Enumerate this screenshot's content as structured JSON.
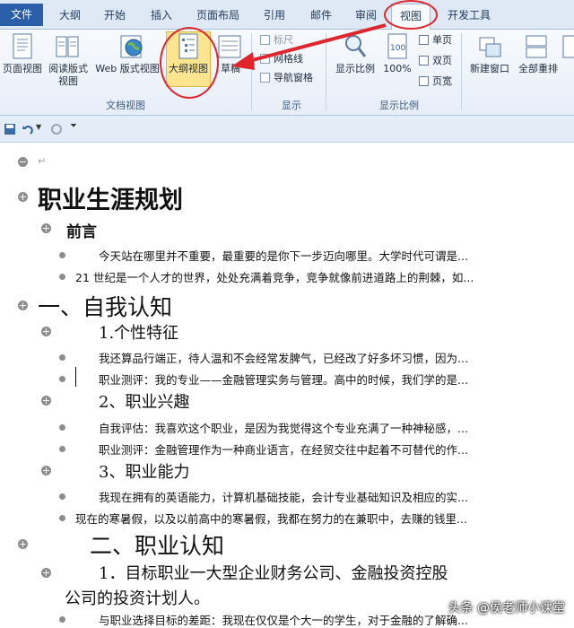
{
  "tabs": [
    "文件",
    "大纲",
    "开始",
    "插入",
    "页面布局",
    "引用",
    "邮件",
    "审阅",
    "视图",
    "开发工具"
  ],
  "ribbon": {
    "doc_views": {
      "buttons": [
        "页面视图",
        "阅读版式\n视图",
        "Web 版式视图",
        "大纲视图",
        "草稿"
      ],
      "label": "文档视图"
    },
    "show": {
      "items": [
        "标尺",
        "网格线",
        "导航窗格"
      ],
      "label": "显示"
    },
    "zoom": {
      "buttons": [
        "显示比例",
        "100%"
      ],
      "small": [
        "单页",
        "双页",
        "页宽"
      ],
      "label": "显示比例"
    },
    "window": {
      "buttons": [
        "新建窗口",
        "全部重排"
      ]
    }
  },
  "document": {
    "lines": [
      {
        "text": "",
        "style": "empty"
      },
      {
        "text": "职业生涯规划",
        "style": "h1"
      },
      {
        "text": "前言",
        "style": "h2"
      },
      {
        "text": "今天站在哪里并不重要，最重要的是你下一步迈向哪里。大学时代可谓是...",
        "style": "body"
      },
      {
        "text": "21 世纪是一个人才的世界，处处充满着竞争，竞争就像前进道路上的荆棘，如...",
        "style": "body"
      },
      {
        "text": "一、自我认知",
        "style": "h1b"
      },
      {
        "text": "1.个性特征",
        "style": "h3"
      },
      {
        "text": "我还算品行端正，待人温和不会经常发脾气，已经改了好多坏习惯，因为...",
        "style": "body"
      },
      {
        "text": "职业测评：我的专业——金融管理实务与管理。高中的时候，我们学的是...",
        "style": "body"
      },
      {
        "text": "2、职业兴趣",
        "style": "h3"
      },
      {
        "text": "自我评估：我喜欢这个职业，是因为我觉得这个专业充满了一种神秘感，...",
        "style": "body"
      },
      {
        "text": "职业测评：金融管理作为一种商业语言，在经贸交往中起着不可替代的作...",
        "style": "body"
      },
      {
        "text": "3、职业能力",
        "style": "h3"
      },
      {
        "text": "我现在拥有的英语能力，计算机基础技能，会计专业基础知识及相应的实...",
        "style": "body"
      },
      {
        "text": "现在的寒暑假，以及以前高中的寒暑假，我都在努力的在兼职中，去赚的钱里...",
        "style": "body"
      },
      {
        "text": "二、职业认知",
        "style": "h1c"
      },
      {
        "text": "1．目标职业一大型企业财务公司、金融投资控股",
        "style": "h2b"
      },
      {
        "text": "公司的投资计划人。",
        "style": "h2b"
      },
      {
        "text": "与职业选择目标的差距：我现在仅仅是个大一的学生，对于金融的了解确...",
        "style": "body"
      }
    ]
  },
  "watermark": "头条 @侯老师小课堂"
}
